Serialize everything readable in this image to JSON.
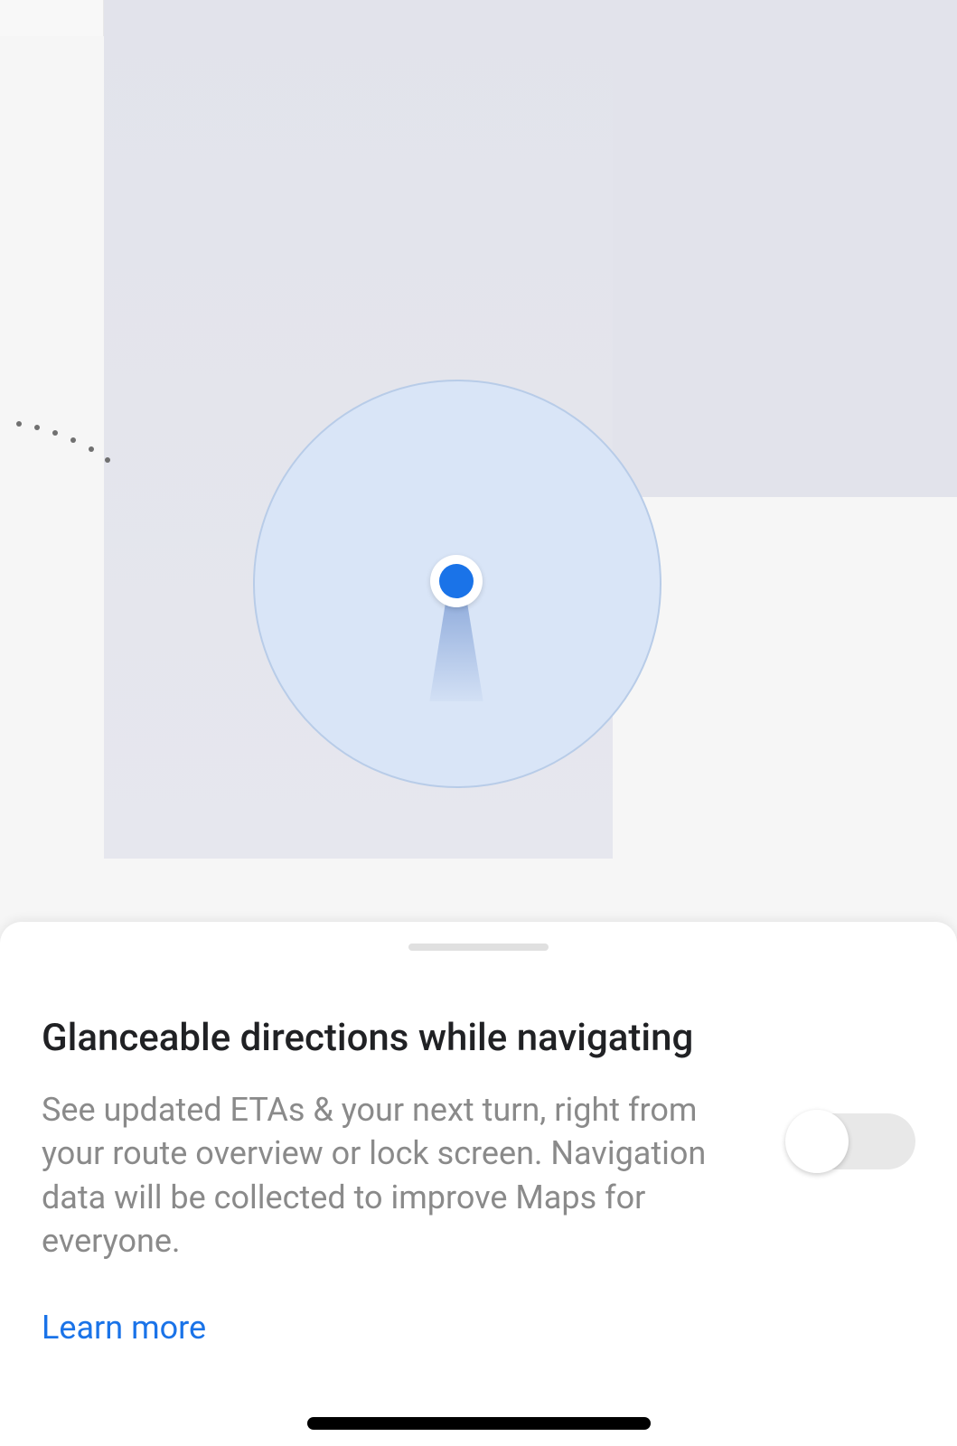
{
  "sheet": {
    "title": "Glanceable directions while navigating",
    "description": "See updated ETAs & your next turn, right from your route overview or lock screen. Navigation data will be collected to improve Maps for everyone.",
    "learn_more": "Learn more",
    "toggle_on": false
  },
  "colors": {
    "primary_blue": "#1a73e8",
    "accuracy_fill": "#d9e5f7",
    "grey_text": "#8a8a8a"
  }
}
